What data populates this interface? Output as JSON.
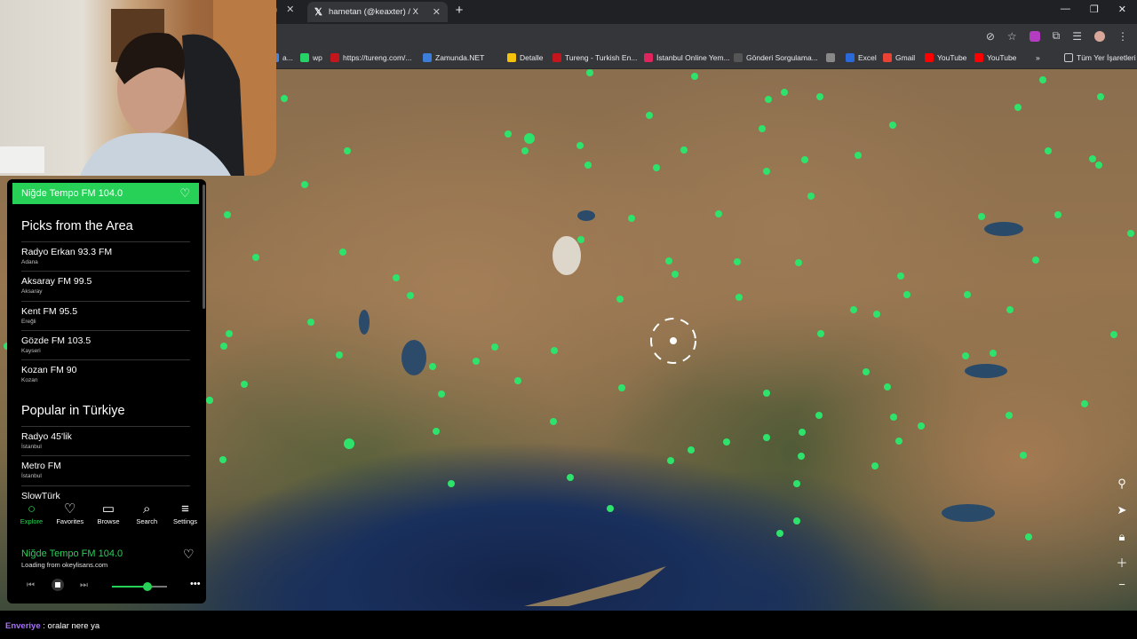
{
  "browser": {
    "tab_title": "hametan (@keaxter) / X",
    "bookmarks": [
      {
        "label": "a...",
        "icon_color": "#4285f4"
      },
      {
        "label": "wp",
        "icon_color": "#25d366"
      },
      {
        "label": "https://tureng.com/...",
        "icon_color": "#c4161c"
      },
      {
        "label": "Zamunda.NET",
        "icon_color": "#3b7dd8"
      },
      {
        "label": "Detalle",
        "icon_color": "#f4c20d"
      },
      {
        "label": "Tureng - Turkish En...",
        "icon_color": "#c4161c"
      },
      {
        "label": "İstanbul Online Yem...",
        "icon_color": "#e0245e"
      },
      {
        "label": "Gönderi Sorgulama...",
        "icon_color": "#555555"
      },
      {
        "label": "",
        "icon_color": "#888888"
      },
      {
        "label": "Excel",
        "icon_color": "#2a6ad8"
      },
      {
        "label": "Gmail",
        "icon_color": "#ea4335"
      },
      {
        "label": "YouTube",
        "icon_color": "#ff0000"
      },
      {
        "label": "YouTube",
        "icon_color": "#ff0000"
      }
    ],
    "all_bookmarks_label": "Tüm Yer İşaretleri",
    "overflow_label": "»"
  },
  "panel": {
    "now_playing_bar": "Niğde Tempo FM 104.0",
    "picks_title": "Picks from the Area",
    "picks": [
      {
        "name": "Radyo Erkan 93.3 FM",
        "city": "Adana"
      },
      {
        "name": "Aksaray FM 99.5",
        "city": "Aksaray"
      },
      {
        "name": "Kent FM 95.5",
        "city": "Ereğli"
      },
      {
        "name": "Gözde FM 103.5",
        "city": "Kayseri"
      },
      {
        "name": "Kozan FM 90",
        "city": "Kozan"
      }
    ],
    "popular_title": "Popular in Türkiye",
    "popular": [
      {
        "name": "Radyo 45'lik",
        "city": "İstanbul"
      },
      {
        "name": "Metro FM",
        "city": "İstanbul"
      },
      {
        "name": "SlowTürk",
        "city": ""
      }
    ],
    "nav": [
      {
        "label": "Explore",
        "icon": "explore-icon",
        "active": true
      },
      {
        "label": "Favorites",
        "icon": "heart-icon",
        "active": false
      },
      {
        "label": "Browse",
        "icon": "map-icon",
        "active": false
      },
      {
        "label": "Search",
        "icon": "search-icon",
        "active": false
      },
      {
        "label": "Settings",
        "icon": "menu-icon",
        "active": false
      }
    ],
    "player": {
      "title": "Niğde Tempo FM 104.0",
      "subtitle": "Loading from okeylisans.com",
      "volume": 0.65
    }
  },
  "chat": {
    "user": "Enveriye",
    "message": ": oralar nere ya"
  },
  "colors": {
    "accent": "#27d157",
    "station_dot": "#2ee36b",
    "chat_user": "#a970ff"
  }
}
